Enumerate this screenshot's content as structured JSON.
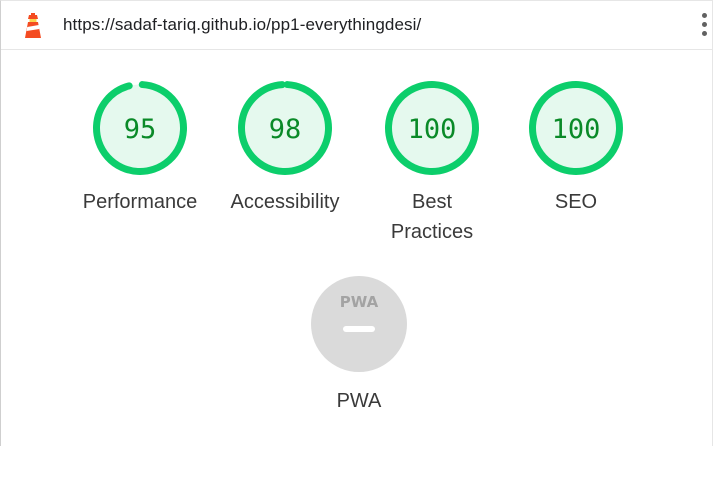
{
  "url": "https://sadaf-tariq.github.io/pp1-everythingdesi/",
  "icons": {
    "site_icon": "lighthouse-icon",
    "menu": "more-vert-icon"
  },
  "colors": {
    "pass_green": "#0cce6b",
    "pass_fill": "#e5f9ee",
    "pass_text": "#0a8a28",
    "pwa_gray": "#dadada"
  },
  "scores": [
    {
      "value": "95",
      "label": "Performance",
      "percent": 95
    },
    {
      "value": "98",
      "label": "Accessibility",
      "percent": 98
    },
    {
      "value": "100",
      "label": "Best Practices",
      "percent": 100
    },
    {
      "value": "100",
      "label": "SEO",
      "percent": 100
    }
  ],
  "pwa": {
    "badge_text": "PWA",
    "label": "PWA"
  }
}
